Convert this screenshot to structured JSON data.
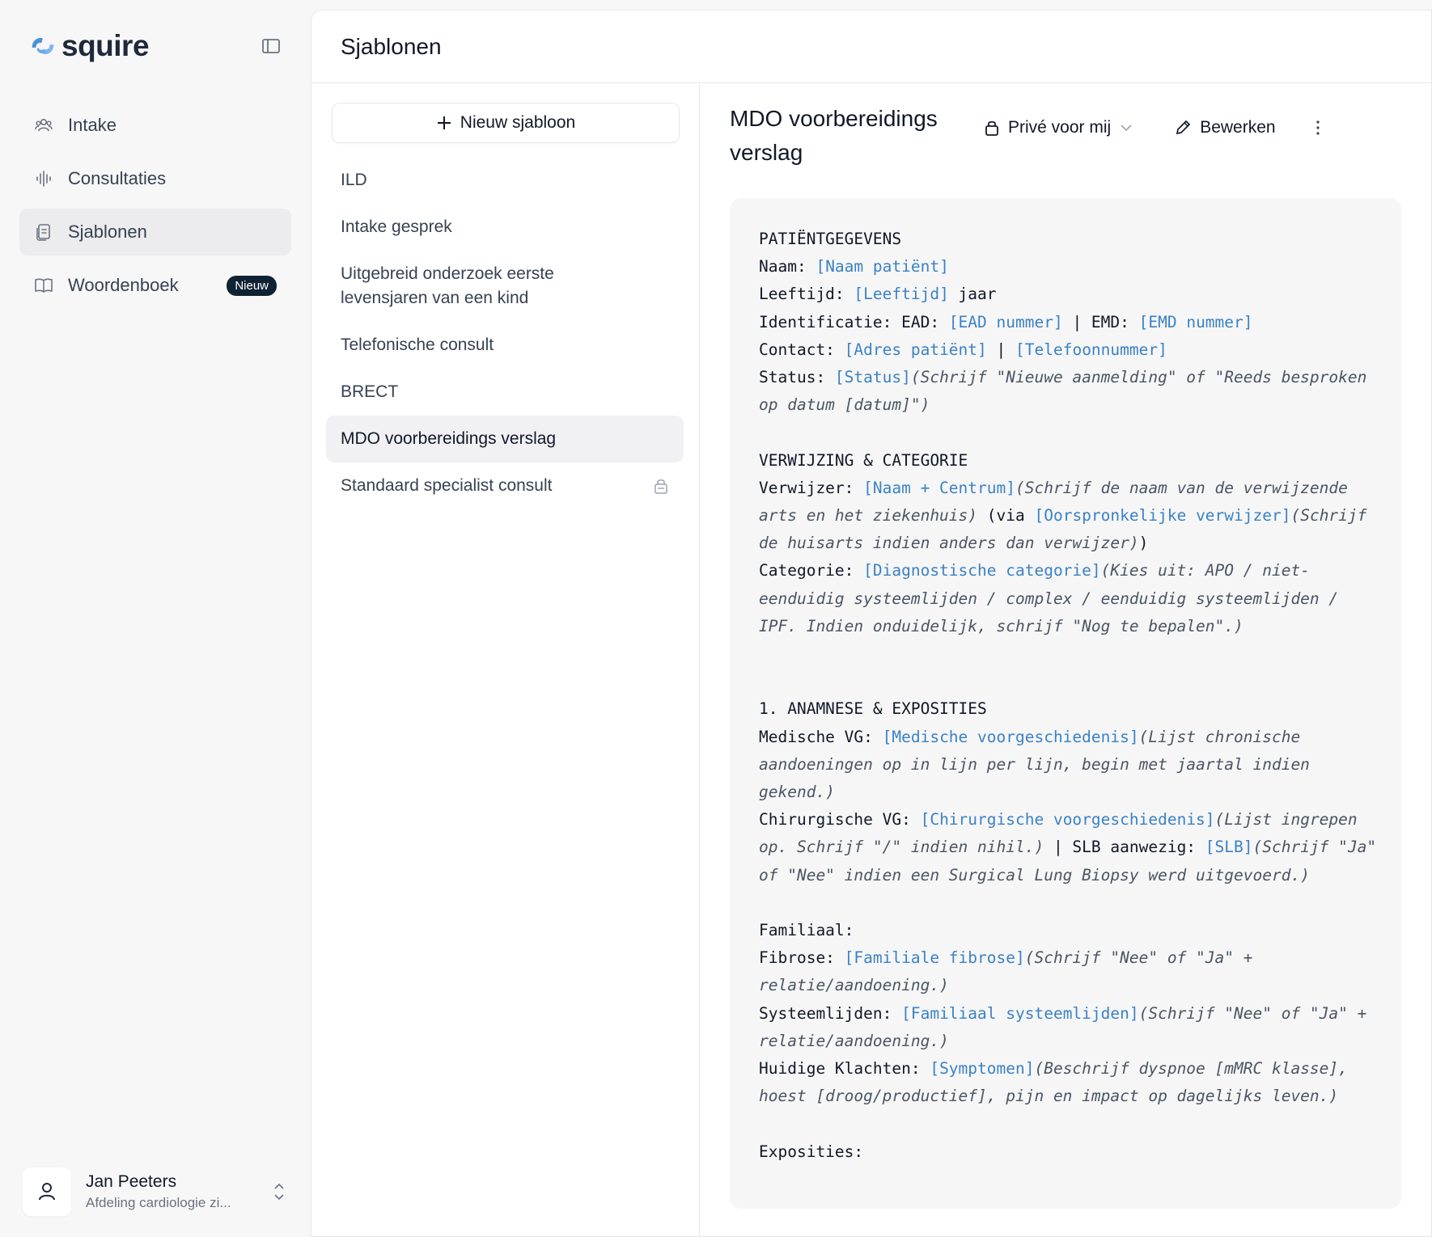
{
  "brand": {
    "name": "squire"
  },
  "sidebar": {
    "items": [
      {
        "label": "Intake",
        "icon": "users-icon"
      },
      {
        "label": "Consultaties",
        "icon": "waveform-icon"
      },
      {
        "label": "Sjablonen",
        "icon": "documents-icon",
        "active": true
      },
      {
        "label": "Woordenboek",
        "icon": "book-icon",
        "badge": "Nieuw"
      }
    ],
    "user": {
      "name": "Jan Peeters",
      "department": "Afdeling cardiologie zi..."
    }
  },
  "header": {
    "title": "Sjablonen"
  },
  "templates": {
    "new_button": "Nieuw sjabloon",
    "items": [
      {
        "label": "ILD"
      },
      {
        "label": "Intake gesprek"
      },
      {
        "label": "Uitgebreid onderzoek eerste levensjaren van een kind"
      },
      {
        "label": "Telefonische consult"
      },
      {
        "label": "BRECT"
      },
      {
        "label": "MDO voorbereidings verslag",
        "active": true
      },
      {
        "label": "Standaard specialist consult",
        "locked": true
      }
    ]
  },
  "detail": {
    "title": "MDO voorbereidings verslag",
    "privacy": "Privé voor mij",
    "edit": "Bewerken",
    "lines": [
      [
        {
          "t": "PATIËNTGEGEVENS"
        }
      ],
      [
        {
          "t": "Naam: "
        },
        {
          "t": "[Naam patiënt]",
          "k": "ph"
        }
      ],
      [
        {
          "t": "Leeftijd: "
        },
        {
          "t": "[Leeftijd]",
          "k": "ph"
        },
        {
          "t": " jaar"
        }
      ],
      [
        {
          "t": "Identificatie: EAD: "
        },
        {
          "t": "[EAD nummer]",
          "k": "ph"
        },
        {
          "t": " | EMD: "
        },
        {
          "t": "[EMD nummer]",
          "k": "ph"
        }
      ],
      [
        {
          "t": "Contact: "
        },
        {
          "t": "[Adres patiënt]",
          "k": "ph"
        },
        {
          "t": " | "
        },
        {
          "t": "[Telefoonnummer]",
          "k": "ph"
        }
      ],
      [
        {
          "t": "Status: "
        },
        {
          "t": "[Status]",
          "k": "ph"
        },
        {
          "t": "(Schrijf \"Nieuwe aanmelding\" of \"Reeds besproken op datum [datum]\")",
          "k": "it"
        }
      ],
      [],
      [
        {
          "t": "VERWIJZING & CATEGORIE"
        }
      ],
      [
        {
          "t": "Verwijzer: "
        },
        {
          "t": "[Naam + Centrum]",
          "k": "ph"
        },
        {
          "t": "(Schrijf de naam van de verwijzende arts en het ziekenhuis)",
          "k": "it"
        },
        {
          "t": " (via "
        },
        {
          "t": "[Oorspronkelijke verwijzer]",
          "k": "ph"
        },
        {
          "t": "(Schrijf de huisarts indien anders dan verwijzer)",
          "k": "it"
        },
        {
          "t": ")"
        }
      ],
      [
        {
          "t": "Categorie: "
        },
        {
          "t": "[Diagnostische categorie]",
          "k": "ph"
        },
        {
          "t": "(Kies uit: APO / niet-eenduidig systeemlijden / complex / eenduidig systeemlijden / IPF. Indien onduidelijk, schrijf \"Nog te bepalen\".)",
          "k": "it"
        }
      ],
      [],
      [],
      [
        {
          "t": "1. ANAMNESE & EXPOSITIES"
        }
      ],
      [
        {
          "t": "Medische VG: "
        },
        {
          "t": "[Medische voorgeschiedenis]",
          "k": "ph"
        },
        {
          "t": "(Lijst chronische aandoeningen op in lijn per lijn, begin met jaartal indien gekend.)",
          "k": "it"
        }
      ],
      [
        {
          "t": "Chirurgische VG: "
        },
        {
          "t": "[Chirurgische voorgeschiedenis]",
          "k": "ph"
        },
        {
          "t": "(Lijst ingrepen op. Schrijf \"/\" indien nihil.)",
          "k": "it"
        },
        {
          "t": " | SLB aanwezig: "
        },
        {
          "t": "[SLB]",
          "k": "ph"
        },
        {
          "t": "(Schrijf \"Ja\" of \"Nee\" indien een Surgical Lung Biopsy werd uitgevoerd.)",
          "k": "it"
        }
      ],
      [],
      [
        {
          "t": "Familiaal:"
        }
      ],
      [
        {
          "t": "Fibrose: "
        },
        {
          "t": "[Familiale fibrose]",
          "k": "ph"
        },
        {
          "t": "(Schrijf \"Nee\" of \"Ja\" + relatie/aandoening.)",
          "k": "it"
        }
      ],
      [
        {
          "t": "Systeemlijden: "
        },
        {
          "t": "[Familiaal systeemlijden]",
          "k": "ph"
        },
        {
          "t": "(Schrijf \"Nee\" of \"Ja\" + relatie/aandoening.)",
          "k": "it"
        }
      ],
      [
        {
          "t": "Huidige Klachten: "
        },
        {
          "t": "[Symptomen]",
          "k": "ph"
        },
        {
          "t": "(Beschrijf dyspnoe [mMRC klasse], hoest [droog/productief], pijn en impact op dagelijks leven.)",
          "k": "it"
        }
      ],
      [],
      [
        {
          "t": "Exposities:"
        }
      ]
    ]
  }
}
